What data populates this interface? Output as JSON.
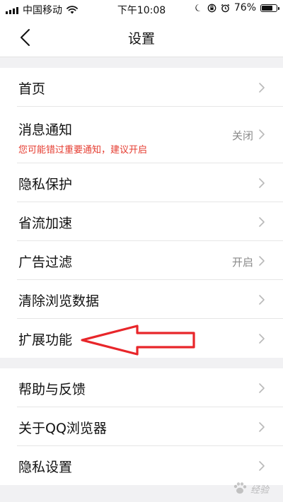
{
  "status_bar": {
    "carrier": "中国移动",
    "time": "下午10:08",
    "battery_percent": "76%",
    "battery_level": 0.76
  },
  "nav": {
    "title": "设置"
  },
  "groups": [
    {
      "items": [
        {
          "label": "首页"
        },
        {
          "label": "消息通知",
          "sub": "您可能错过重要通知，建议开启",
          "value": "关闭"
        },
        {
          "label": "隐私保护"
        },
        {
          "label": "省流加速"
        },
        {
          "label": "广告过滤",
          "value": "开启"
        },
        {
          "label": "清除浏览数据"
        },
        {
          "label": "扩展功能"
        }
      ]
    },
    {
      "items": [
        {
          "label": "帮助与反馈"
        },
        {
          "label": "关于QQ浏览器"
        },
        {
          "label": "隐私设置"
        }
      ]
    }
  ],
  "watermark": {
    "text": "经验"
  },
  "colors": {
    "annotation_red": "#e8262a",
    "warning_red": "#e53c30",
    "secondary_text": "#8a8a8a"
  },
  "icons": {
    "wifi": "wifi-icon",
    "moon": "moon-icon",
    "orientation_lock": "orientation-lock-icon",
    "alarm": "alarm-icon",
    "chevron": "chevron-right-icon",
    "back": "chevron-left-icon",
    "watermark_logo": "paw-icon"
  }
}
